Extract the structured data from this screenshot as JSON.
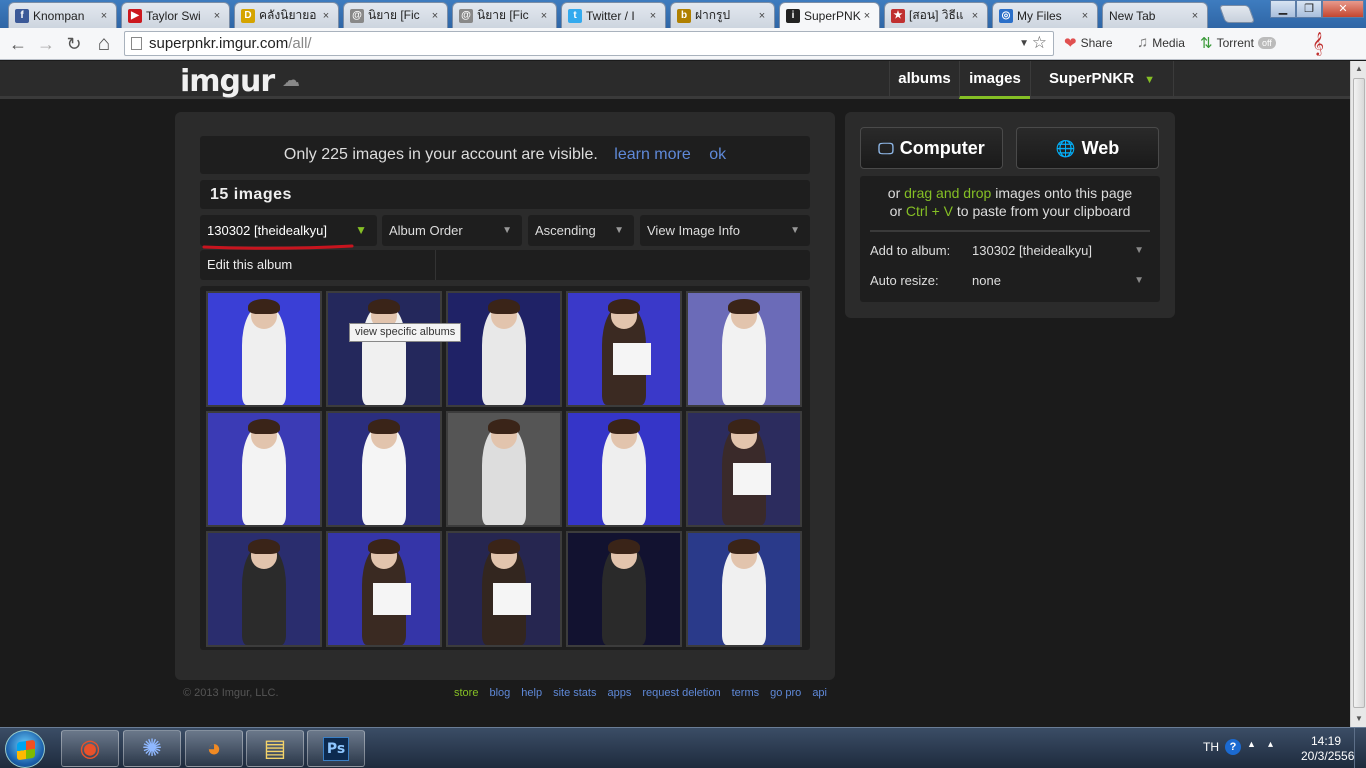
{
  "browser": {
    "tabs": [
      {
        "label": "Knompan",
        "favicon": "facebook-icon",
        "color": "#3b5998",
        "glyph": "f"
      },
      {
        "label": "Taylor Swi",
        "favicon": "youtube-icon",
        "color": "#cc181e",
        "glyph": "▶"
      },
      {
        "label": "คลังนิยายอ",
        "favicon": "book-icon",
        "color": "#d5a400",
        "glyph": "D"
      },
      {
        "label": "นิยาย [Fic",
        "favicon": "swirl-icon",
        "color": "#888888",
        "glyph": "@"
      },
      {
        "label": "นิยาย [Fic",
        "favicon": "swirl-icon",
        "color": "#888888",
        "glyph": "@"
      },
      {
        "label": "Twitter / I",
        "favicon": "twitter-icon",
        "color": "#33aaee",
        "glyph": "t"
      },
      {
        "label": "ฝากรูป",
        "favicon": "upload-icon",
        "color": "#b08000",
        "glyph": "b"
      },
      {
        "label": "SuperPNK",
        "favicon": "imgur-icon",
        "color": "#222222",
        "glyph": "i"
      },
      {
        "label": "[สอน] วิธีแ",
        "favicon": "anime-icon",
        "color": "#c03030",
        "glyph": "★"
      },
      {
        "label": "My Files",
        "favicon": "cloud-icon",
        "color": "#2a6fc9",
        "glyph": "◎"
      },
      {
        "label": "New Tab",
        "favicon": "",
        "color": "#ffffff",
        "glyph": ""
      }
    ],
    "close_glyph": "×",
    "window_controls": {
      "minimize": "▁",
      "maximize": "❐",
      "close": "✕"
    },
    "url_host": "superpnkr.imgur.com",
    "url_path": "/all/",
    "back": "←",
    "forward": "→",
    "reload": "↻",
    "home": "⌂",
    "star": "☆",
    "url_drop": "▼",
    "extensions": [
      {
        "label": "Share",
        "icon": "heart-icon",
        "glyph": "❤",
        "color": "#e05050"
      },
      {
        "label": "Media",
        "icon": "media-icon",
        "glyph": "♫",
        "color": "#777777"
      },
      {
        "label": "Torrent",
        "icon": "torrent-icon",
        "glyph": "⇅",
        "color": "#3a9a3a"
      }
    ],
    "torrent_badge": "off",
    "menu_glyph": "𝄞"
  },
  "imgur": {
    "logo": "imgur",
    "nav": {
      "albums": "albums",
      "images": "images",
      "user": "SuperPNKR",
      "user_caret": "▼"
    },
    "notice": {
      "text": "Only 225 images in your account are visible.",
      "learn_more": "learn more",
      "ok": "ok"
    },
    "image_count": "15 images",
    "dropdowns": {
      "album": "130302 [theidealkyu]",
      "order": "Album Order",
      "direction": "Ascending",
      "view": "View Image Info",
      "caret": "⌵",
      "album_caret": "⌄"
    },
    "edit_album": "Edit this album",
    "tooltip": "view specific albums",
    "thumbnails": [
      {
        "name": "thumb-1",
        "bg": "#3a3fd6",
        "fig": "#efefef"
      },
      {
        "name": "thumb-2",
        "bg": "#24285c",
        "fig": "#f0f0f0"
      },
      {
        "name": "thumb-3",
        "bg": "#1f2266",
        "fig": "#e8e8e8"
      },
      {
        "name": "thumb-4",
        "bg": "#3a39c9",
        "fig": "#3b2a22"
      },
      {
        "name": "thumb-5",
        "bg": "#6b6bb8",
        "fig": "#f2f2f2"
      },
      {
        "name": "thumb-6",
        "bg": "#3b3bb5",
        "fig": "#f3f3f3"
      },
      {
        "name": "thumb-7",
        "bg": "#2b2e7e",
        "fig": "#f5f5f5"
      },
      {
        "name": "thumb-8",
        "bg": "#555555",
        "fig": "#dddddd"
      },
      {
        "name": "thumb-9",
        "bg": "#3535c8",
        "fig": "#eeeeee"
      },
      {
        "name": "thumb-10",
        "bg": "#2c2c5e",
        "fig": "#3a2a2a"
      },
      {
        "name": "thumb-11",
        "bg": "#2a2d6e",
        "fig": "#2b2b2b"
      },
      {
        "name": "thumb-12",
        "bg": "#3535a8",
        "fig": "#3a2a22"
      },
      {
        "name": "thumb-13",
        "bg": "#262650",
        "fig": "#33261f"
      },
      {
        "name": "thumb-14",
        "bg": "#121230",
        "fig": "#2a2a2a"
      },
      {
        "name": "thumb-15",
        "bg": "#2a3a8a",
        "fig": "#f0f0f0"
      }
    ],
    "upload": {
      "computer": "Computer",
      "web": "Web",
      "drop_line1_prefix": "or ",
      "drop_line1_hl": "drag and drop",
      "drop_line1_suffix": " images onto this page",
      "drop_line2_prefix": "or ",
      "drop_line2_hl": "Ctrl + V",
      "drop_line2_suffix": " to paste from your clipboard",
      "add_to_album_label": "Add to album:",
      "add_to_album_value": "130302 [theidealkyu]",
      "auto_resize_label": "Auto resize:",
      "auto_resize_value": "none"
    },
    "footer": {
      "copyright": "© 2013 Imgur, LLC.",
      "links": [
        "store",
        "blog",
        "help",
        "site stats",
        "apps",
        "request deletion",
        "terms",
        "go pro",
        "api"
      ]
    }
  },
  "taskbar": {
    "apps": [
      {
        "name": "chrome-taskbar-button",
        "glyph": "◉",
        "color": "#e8522b"
      },
      {
        "name": "network-taskbar-button",
        "glyph": "✺",
        "color": "#8fb8ff"
      },
      {
        "name": "firefox-taskbar-button",
        "glyph": "◕",
        "color": "#f08a24"
      },
      {
        "name": "explorer-taskbar-button",
        "glyph": "▤",
        "color": "#f3d36a"
      }
    ],
    "photoshop": "Ps",
    "language": "TH",
    "help": "?",
    "tray_arrow": "▲",
    "flag_arrow": "▴",
    "time": "14:19",
    "date": "20/3/2556"
  },
  "colors": {
    "accent_green": "#85bf25",
    "link_blue": "#5f89d8",
    "annotation_red": "#c8141e"
  }
}
